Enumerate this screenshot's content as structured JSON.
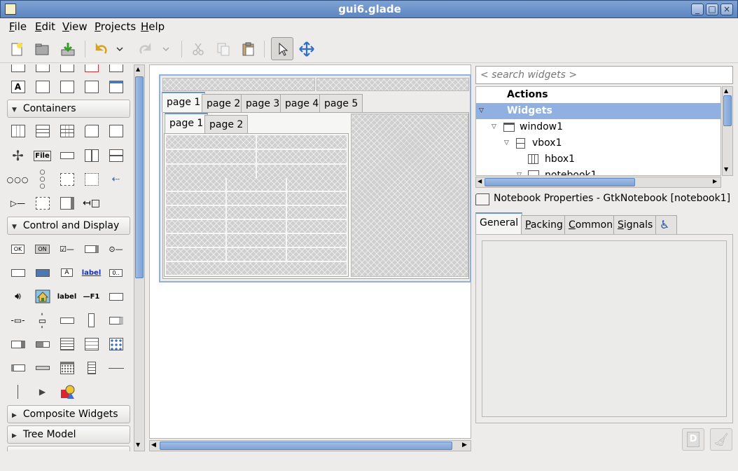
{
  "window": {
    "title": "gui6.glade"
  },
  "menu": [
    {
      "label": "File",
      "mnemonic": "F",
      "rest": "ile"
    },
    {
      "label": "Edit",
      "mnemonic": "E",
      "rest": "dit"
    },
    {
      "label": "View",
      "mnemonic": "V",
      "rest": "iew"
    },
    {
      "label": "Projects",
      "mnemonic": "P",
      "rest": "rojects"
    },
    {
      "label": "Help",
      "mnemonic": "H",
      "rest": "elp"
    }
  ],
  "palette": {
    "groups": {
      "containers": "Containers",
      "control_display": "Control and Display",
      "composite": "Composite Widgets",
      "tree_model": "Tree Model"
    },
    "icon_texts": {
      "file": "File",
      "ok": "OK",
      "on": "ON",
      "label_link": "label",
      "label": "label",
      "f1": "—F1",
      "spin": "0.."
    }
  },
  "design": {
    "outer_tabs": [
      "page 1",
      "page 2",
      "page 3",
      "page 4",
      "page 5"
    ],
    "inner_tabs": [
      "page 1",
      "page 2"
    ]
  },
  "inspector": {
    "search_placeholder": "< search widgets >",
    "tree": {
      "actions": "Actions",
      "widgets": "Widgets",
      "window1": "window1",
      "vbox1": "vbox1",
      "hbox1": "hbox1",
      "notebook1": "notebook1"
    }
  },
  "properties": {
    "header": "Notebook Properties - GtkNotebook [notebook1]",
    "tabs": {
      "general": "General",
      "packing": "Packing",
      "common": "Common",
      "signals": "Signals"
    }
  },
  "colors": {
    "accent": "#6b93cf",
    "selection": "#8fb0e0",
    "titlebar": "#6a8fc8"
  }
}
